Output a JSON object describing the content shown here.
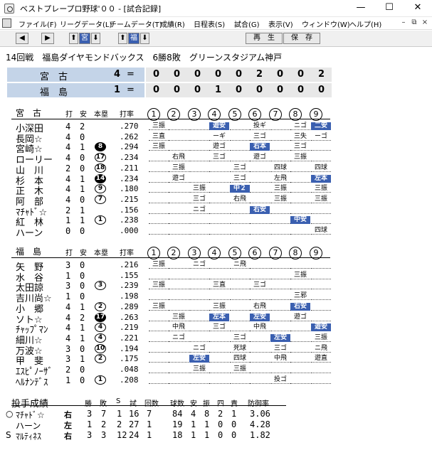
{
  "window": {
    "title": "ベストプレープロ野球'００ - [試合記録]",
    "min": "—",
    "max": "☐",
    "close": "✕"
  },
  "menu": [
    "ファイル(F)",
    "リーグデータ(L)",
    "チームデータ(T)",
    "成績(R)",
    "日程表(S)",
    "試合(G)",
    "表示(V)",
    "ウィンドウ(W)",
    "ヘルプ(H)"
  ],
  "mdi": {
    "min": "–",
    "restore": "⧉",
    "close": "×"
  },
  "toolbar": {
    "left": "◀",
    "right": "▶",
    "up1": "⬆",
    "team1": "宮",
    "down1": "⬇",
    "up2": "⬆",
    "team2": "福",
    "down2": "⬇",
    "replay": "再　生",
    "save": "保　存"
  },
  "game": {
    "header": "14回戦　福島ダイヤモンドバックス　6勝8敗　グリーンスタジアム神戸"
  },
  "scoreboard": [
    {
      "team": "宮　古",
      "runs": "4",
      "innings": [
        "0",
        "0",
        "0",
        "0",
        "0",
        "2",
        "0",
        "0",
        "2"
      ]
    },
    {
      "team": "福　島",
      "runs": "1",
      "innings": [
        "0",
        "0",
        "0",
        "1",
        "0",
        "0",
        "0",
        "0",
        "0"
      ]
    }
  ],
  "columns": {
    "ab": "打",
    "hits": "安",
    "hr": "本塁",
    "avg": "打率",
    "innings": [
      "1",
      "2",
      "3",
      "4",
      "5",
      "6",
      "7",
      "8",
      "9"
    ]
  },
  "away": {
    "team": "宮　古",
    "players": [
      {
        "name": "小深田",
        "ab": "4",
        "h": "2",
        "hr": "",
        "hrdark": false,
        "avg": ".270",
        "cells": [
          "三振",
          "",
          "",
          "遊安",
          "",
          "投ギ",
          "",
          "ニゴ",
          "二安"
        ],
        "hi": [
          3,
          8
        ]
      },
      {
        "name": "長岡☆",
        "ab": "4",
        "h": "0",
        "hr": "",
        "hrdark": false,
        "avg": ".262",
        "cells": [
          "三直",
          "",
          "",
          "ーギ",
          "",
          "三ゴ",
          "",
          "三失",
          "ーゴ"
        ],
        "hi": []
      },
      {
        "name": "宮崎☆",
        "ab": "4",
        "h": "1",
        "hr": "8",
        "hrdark": true,
        "avg": ".294",
        "cells": [
          "三振",
          "",
          "",
          "遊ゴ",
          "",
          "右本",
          "",
          "三ゴ",
          ""
        ],
        "hi": [
          5
        ]
      },
      {
        "name": "ローリー",
        "ab": "4",
        "h": "0",
        "hr": "17",
        "hrdark": false,
        "avg": ".234",
        "cells": [
          "",
          "右飛",
          "",
          "三ゴ",
          "",
          "遊ゴ",
          "",
          "三振",
          ""
        ],
        "hi": []
      },
      {
        "name": "山　川",
        "ab": "2",
        "h": "0",
        "hr": "18",
        "hrdark": false,
        "avg": ".211",
        "cells": [
          "",
          "三振",
          "",
          "",
          "三ゴ",
          "",
          "四球",
          "",
          "四球"
        ],
        "hi": []
      },
      {
        "name": "杉　本",
        "ab": "4",
        "h": "1",
        "hr": "14",
        "hrdark": true,
        "avg": ".234",
        "cells": [
          "",
          "遊ゴ",
          "",
          "",
          "三ゴ",
          "",
          "左飛",
          "",
          "左本"
        ],
        "hi": [
          8
        ]
      },
      {
        "name": "正　木",
        "ab": "4",
        "h": "1",
        "hr": "9",
        "hrdark": false,
        "avg": ".180",
        "cells": [
          "",
          "",
          "三振",
          "",
          "中２",
          "",
          "三振",
          "",
          "三振"
        ],
        "hi": [
          4
        ]
      },
      {
        "name": "阿　部",
        "ab": "4",
        "h": "0",
        "hr": "7",
        "hrdark": false,
        "avg": ".215",
        "cells": [
          "",
          "",
          "三ゴ",
          "",
          "右飛",
          "",
          "三振",
          "",
          "三振"
        ],
        "hi": []
      },
      {
        "name": "ﾏﾁｬﾄﾞ☆",
        "ab": "2",
        "h": "1",
        "hr": "",
        "hrdark": false,
        "avg": ".156",
        "cells": [
          "",
          "",
          "ニゴ",
          "",
          "",
          "右安",
          "",
          "",
          ""
        ],
        "hi": [
          5
        ]
      },
      {
        "name": "紅　林",
        "ab": "1",
        "h": "1",
        "hr": "1",
        "hrdark": false,
        "avg": ".238",
        "cells": [
          "",
          "",
          "",
          "",
          "",
          "",
          "",
          "中安",
          ""
        ],
        "hi": [
          7
        ]
      },
      {
        "name": "ハーン",
        "ab": "0",
        "h": "0",
        "hr": "",
        "hrdark": false,
        "avg": ".000",
        "cells": [
          "",
          "",
          "",
          "",
          "",
          "",
          "",
          "",
          "四球"
        ],
        "hi": []
      }
    ]
  },
  "home": {
    "team": "福　島",
    "players": [
      {
        "name": "矢　野",
        "ab": "3",
        "h": "0",
        "hr": "",
        "hrdark": false,
        "avg": ".216",
        "cells": [
          "三振",
          "",
          "ニゴ",
          "",
          "ニ飛",
          "",
          "",
          "",
          ""
        ],
        "hi": []
      },
      {
        "name": "水　谷",
        "ab": "1",
        "h": "0",
        "hr": "",
        "hrdark": false,
        "avg": ".155",
        "cells": [
          "",
          "",
          "",
          "",
          "",
          "",
          "",
          "三振",
          ""
        ],
        "hi": []
      },
      {
        "name": "太田諒",
        "ab": "3",
        "h": "0",
        "hr": "3",
        "hrdark": false,
        "avg": ".239",
        "cells": [
          "三振",
          "",
          "",
          "三直",
          "",
          "三ゴ",
          "",
          "",
          ""
        ],
        "hi": []
      },
      {
        "name": "吉川尚☆",
        "ab": "1",
        "h": "0",
        "hr": "",
        "hrdark": false,
        "avg": ".198",
        "cells": [
          "",
          "",
          "",
          "",
          "",
          "",
          "",
          "三邪",
          ""
        ],
        "hi": []
      },
      {
        "name": "小　郷",
        "ab": "4",
        "h": "1",
        "hr": "2",
        "hrdark": false,
        "avg": ".289",
        "cells": [
          "三振",
          "",
          "",
          "三振",
          "",
          "右飛",
          "",
          "右安",
          ""
        ],
        "hi": [
          7
        ]
      },
      {
        "name": "ソト☆",
        "ab": "4",
        "h": "2",
        "hr": "17",
        "hrdark": true,
        "avg": ".263",
        "cells": [
          "",
          "三振",
          "",
          "左本",
          "",
          "左安",
          "",
          "遊ゴ",
          ""
        ],
        "hi": [
          3,
          5
        ]
      },
      {
        "name": "ﾁｬｯﾌﾟﾏﾝ",
        "ab": "4",
        "h": "1",
        "hr": "4",
        "hrdark": false,
        "avg": ".219",
        "cells": [
          "",
          "中飛",
          "",
          "三ゴ",
          "",
          "中飛",
          "",
          "",
          "遊安"
        ],
        "hi": [
          8
        ]
      },
      {
        "name": "細川☆",
        "ab": "4",
        "h": "1",
        "hr": "4",
        "hrdark": false,
        "avg": ".221",
        "cells": [
          "",
          "ニゴ",
          "",
          "",
          "三ゴ",
          "",
          "左安",
          "",
          "三振"
        ],
        "hi": [
          6
        ]
      },
      {
        "name": "万波☆",
        "ab": "3",
        "h": "0",
        "hr": "10",
        "hrdark": false,
        "avg": ".194",
        "cells": [
          "",
          "",
          "ニゴ",
          "",
          "死球",
          "",
          "三ゴ",
          "",
          "ニ飛"
        ],
        "hi": []
      },
      {
        "name": "甲　斐",
        "ab": "3",
        "h": "1",
        "hr": "2",
        "hrdark": false,
        "avg": ".175",
        "cells": [
          "",
          "",
          "左安",
          "",
          "四球",
          "",
          "中飛",
          "",
          "遊直"
        ],
        "hi": [
          2
        ]
      },
      {
        "name": "ｴｽﾋﾟﾉｰｻﾞ",
        "ab": "2",
        "h": "0",
        "hr": "",
        "hrdark": false,
        "avg": ".048",
        "cells": [
          "",
          "",
          "三振",
          "",
          "三振",
          "",
          "",
          "",
          ""
        ],
        "hi": []
      },
      {
        "name": "ﾍﾙﾅﾝﾃﾞｽ",
        "ab": "1",
        "h": "0",
        "hr": "1",
        "hrdark": false,
        "avg": ".208",
        "cells": [
          "",
          "",
          "",
          "",
          "",
          "",
          "投ゴ",
          "",
          ""
        ],
        "hi": []
      }
    ]
  },
  "pitching": {
    "title": "投手成績",
    "headers": [
      "勝",
      "敗",
      "S",
      "試",
      "回数",
      "球数",
      "安",
      "振",
      "四",
      "責",
      "防御率"
    ],
    "rows": [
      {
        "mark": "○",
        "name": "ﾏﾁｬﾄﾞ☆",
        "hand": "右",
        "vals": [
          "3",
          "7",
          "1",
          "16",
          "7",
          "84",
          "4",
          "8",
          "2",
          "1",
          "3.06"
        ]
      },
      {
        "mark": "",
        "name": "ハーン",
        "hand": "左",
        "vals": [
          "1",
          "2",
          "2",
          "27",
          "1",
          "19",
          "1",
          "1",
          "0",
          "0",
          "4.28"
        ]
      },
      {
        "mark": "S",
        "name": "ﾏﾙﾃｨﾈｽ",
        "hand": "右",
        "vals": [
          "3",
          "3",
          "12",
          "24",
          "1",
          "18",
          "1",
          "1",
          "0",
          "0",
          "1.82"
        ]
      }
    ]
  }
}
